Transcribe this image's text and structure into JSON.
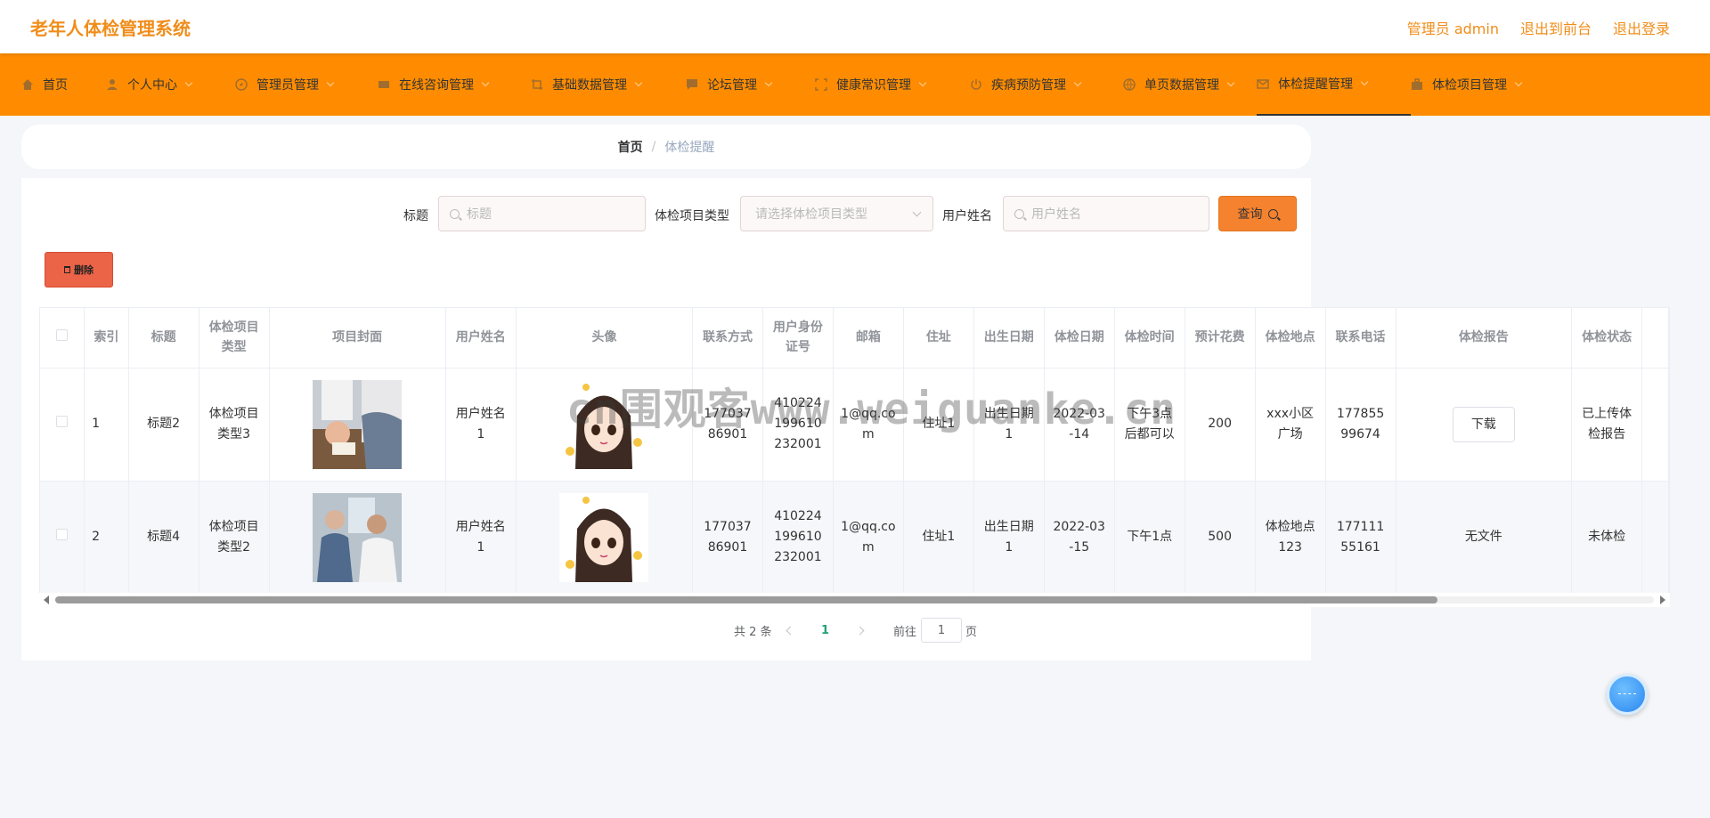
{
  "header": {
    "title": "老年人体检管理系统",
    "links": [
      "管理员 admin",
      "退出到前台",
      "退出登录"
    ]
  },
  "nav": {
    "items": [
      {
        "label": "首页",
        "icon": "home-icon",
        "dropdown": false
      },
      {
        "label": "个人中心",
        "icon": "user-icon",
        "dropdown": true
      },
      {
        "label": "管理员管理",
        "icon": "compass-icon",
        "dropdown": true
      },
      {
        "label": "在线咨询管理",
        "icon": "chat-icon",
        "dropdown": true
      },
      {
        "label": "基础数据管理",
        "icon": "crop-icon",
        "dropdown": true
      },
      {
        "label": "论坛管理",
        "icon": "message-icon",
        "dropdown": true
      },
      {
        "label": "健康常识管理",
        "icon": "fullscreen-icon",
        "dropdown": true
      },
      {
        "label": "疾病预防管理",
        "icon": "power-icon",
        "dropdown": true
      },
      {
        "label": "单页数据管理",
        "icon": "globe-icon",
        "dropdown": true
      },
      {
        "label": "体检提醒管理",
        "icon": "mail-icon",
        "dropdown": true,
        "active": true
      },
      {
        "label": "体检项目管理",
        "icon": "briefcase-icon",
        "dropdown": true
      }
    ]
  },
  "breadcrumb": {
    "home": "首页",
    "separator": "/",
    "current": "体检提醒"
  },
  "search": {
    "title_label": "标题",
    "title_placeholder": "标题",
    "type_label": "体检项目类型",
    "type_placeholder": "请选择体检项目类型",
    "user_label": "用户姓名",
    "user_placeholder": "用户姓名",
    "query_label": "查询"
  },
  "toolbar": {
    "delete_label": "删除"
  },
  "table": {
    "columns": [
      "",
      "索引",
      "标题",
      "体检项目类型",
      "项目封面",
      "用户姓名",
      "头像",
      "联系方式",
      "用户身份证号",
      "邮箱",
      "住址",
      "出生日期",
      "体检日期",
      "体检时间",
      "预计花费",
      "体检地点",
      "联系电话",
      "体检报告",
      "体检状态"
    ],
    "rows": [
      {
        "index": "1",
        "title": "标题2",
        "type": "体检项目类型3",
        "user": "用户姓名1",
        "phone": "17703786901",
        "idcard": "410224199610232001",
        "email": "1@qq.com",
        "address": "住址1",
        "birth": "出生日期1",
        "exam_date": "2022-03-14",
        "exam_time": "下午3点后都可以",
        "cost": "200",
        "location": "xxx小区广场",
        "tel": "17785599674",
        "report": "下载",
        "report_is_button": true,
        "status": "已上传体检报告"
      },
      {
        "index": "2",
        "title": "标题4",
        "type": "体检项目类型2",
        "user": "用户姓名1",
        "phone": "17703786901",
        "idcard": "410224199610232001",
        "email": "1@qq.com",
        "address": "住址1",
        "birth": "出生日期1",
        "exam_date": "2022-03-15",
        "exam_time": "下午1点",
        "cost": "500",
        "location": "体检地点123",
        "tel": "17711155161",
        "report": "无文件",
        "report_is_button": false,
        "status": "未体检"
      }
    ]
  },
  "pagination": {
    "total": "共 2 条",
    "current_page": "1",
    "goto_label": "前往",
    "goto_value": "1",
    "page_suffix": "页"
  },
  "watermark": "cn围观客www.weiguanke.cn",
  "colors": {
    "accent": "#ff8c00",
    "brand_text": "#f08d1a",
    "query_button": "#f5822f",
    "delete_button": "#ec6447",
    "active_page": "#21a179"
  }
}
